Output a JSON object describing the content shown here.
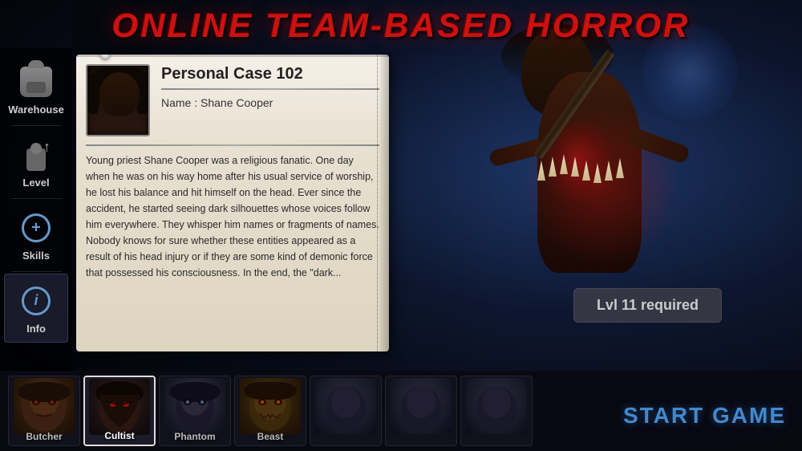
{
  "title": "ONLINE TEAM-BASED HORROR",
  "sidebar": {
    "items": [
      {
        "id": "warehouse",
        "label": "Warehouse",
        "icon": "warehouse-icon"
      },
      {
        "id": "level",
        "label": "Level",
        "icon": "level-icon"
      },
      {
        "id": "skills",
        "label": "Skills",
        "icon": "skills-icon"
      },
      {
        "id": "info",
        "label": "Info",
        "icon": "info-icon",
        "active": true
      }
    ]
  },
  "case_card": {
    "title": "Personal Case 102",
    "name_label": "Name : Shane Cooper",
    "body_text": "Young priest Shane Cooper was a religious fanatic. One day when he was on his way home after his usual service of worship, he lost his balance and hit himself on the head. Ever since the accident, he started seeing dark silhouettes whose voices follow him everywhere. They whisper him names or fragments of names. Nobody knows for sure whether these entities appeared as a result of his head injury or if they are some kind of demonic force that possessed his consciousness. In the end, the \"dark..."
  },
  "level_required": {
    "text": "Lvl 11 required"
  },
  "characters": [
    {
      "id": "butcher",
      "label": "Butcher",
      "active": false
    },
    {
      "id": "cultist",
      "label": "Cultist",
      "active": true
    },
    {
      "id": "phantom",
      "label": "Phantom",
      "active": false
    },
    {
      "id": "beast",
      "label": "Beast",
      "active": false
    },
    {
      "id": "char5",
      "label": "",
      "active": false
    },
    {
      "id": "char6",
      "label": "",
      "active": false
    },
    {
      "id": "char7",
      "label": "",
      "active": false
    }
  ],
  "start_game": {
    "label": "START GAME"
  }
}
